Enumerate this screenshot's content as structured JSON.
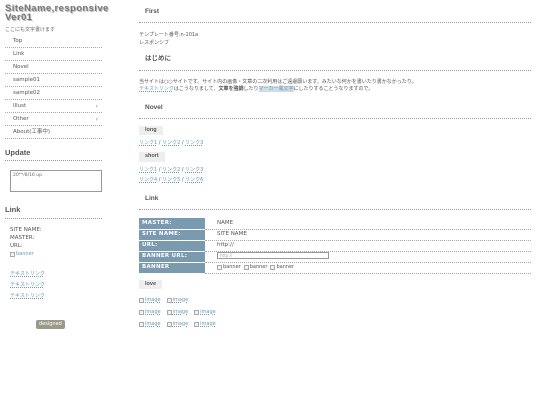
{
  "sidebar": {
    "site_title": "SiteName,responsive Ver01",
    "site_sub": "ここにも文字書けます",
    "menu": [
      {
        "label": "Top",
        "chevron": false
      },
      {
        "label": "Link",
        "chevron": false
      },
      {
        "label": "Novel",
        "chevron": false
      },
      {
        "label": "sample01",
        "chevron": false
      },
      {
        "label": "sample02",
        "chevron": false
      },
      {
        "label": "Illust",
        "chevron": true
      },
      {
        "label": "Other",
        "chevron": true
      },
      {
        "label": "About(工事中)",
        "chevron": false
      }
    ],
    "chevron_glyph": "›",
    "update_heading": "Update",
    "update_text": "20**/8/16 up",
    "link_heading": "Link",
    "site_name_label": "SITE NAME:",
    "master_label": "MASTER:",
    "url_label": "URL:",
    "banner_alt": "banner",
    "text_links": [
      "テキストリンク",
      "テキストリンク",
      "テキストリンク"
    ],
    "design_badge": "designed"
  },
  "main": {
    "first": {
      "heading": "First",
      "line1": "テンプレート番号:n-101a",
      "line2": "レスポンシブ"
    },
    "intro": {
      "heading": "はじめに",
      "text1": "当サイトは○○サイトです。サイト内の画像・文章の二次利用はご遠慮願います。みたいな何かを書いたり書かなかったり。",
      "link_text": "テキストリンク",
      "text2": "はこうなりまして、",
      "bold_text": "文章を強調",
      "text3": "したり",
      "marker_text": "マーカー風文字",
      "text4": "にしたりすることうなりますので。"
    },
    "novel": {
      "heading": "Novel",
      "long_label": "long",
      "long_links": [
        "リンク1",
        "リンク2",
        "リンク3"
      ],
      "short_label": "short",
      "short_links_row1": [
        "リンク1",
        "リンク2",
        "リンク3"
      ],
      "short_links_row2": [
        "リンク4",
        "リンク5",
        "リンク6"
      ],
      "separator": "/"
    },
    "link": {
      "heading": "Link",
      "rows": [
        {
          "label": "MASTER:",
          "value": "NAME"
        },
        {
          "label": "SITE NAME:",
          "value": "SITE NAME"
        },
        {
          "label": "URL:",
          "value": "http://"
        },
        {
          "label": "BANNER URL:",
          "value": "http://"
        },
        {
          "label": "BANNER",
          "value": ""
        }
      ],
      "banner_alts": [
        "banner",
        "banner",
        "banner"
      ],
      "love_label": "love",
      "image_alt": "image"
    }
  },
  "colors": {
    "accent": "#7a9ab0",
    "link": "#6a9ab0"
  }
}
